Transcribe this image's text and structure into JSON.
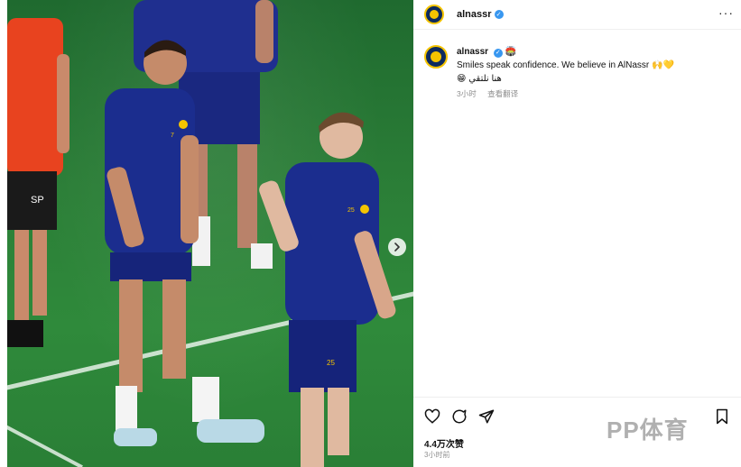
{
  "post": {
    "username": "alnassr",
    "caption_user": "alnassr",
    "caption_badge": "🏟️",
    "caption_line1": "Smiles speak confidence. We believe in AlNassr 🙌💛",
    "caption_line2": "😁 هنا نلتقي",
    "time_ago": "3小时",
    "translate_label": "查看翻译",
    "likes": "4.4万次赞",
    "posted_ago": "3小时前",
    "more_label": "···"
  },
  "watermark": "PP体育",
  "photo": {
    "player_left_number": "7",
    "player_right_number": "25",
    "shirt_text": "SP"
  },
  "icons": {
    "verified": "verified-icon",
    "like": "heart-icon",
    "comment": "comment-icon",
    "share": "share-icon",
    "save": "bookmark-icon",
    "next": "chevron-right-icon"
  },
  "colors": {
    "pitch": "#2b7e37",
    "kit_blue": "#1b2d8e",
    "kit_yellow": "#f5c400",
    "verified": "#3897f0"
  }
}
